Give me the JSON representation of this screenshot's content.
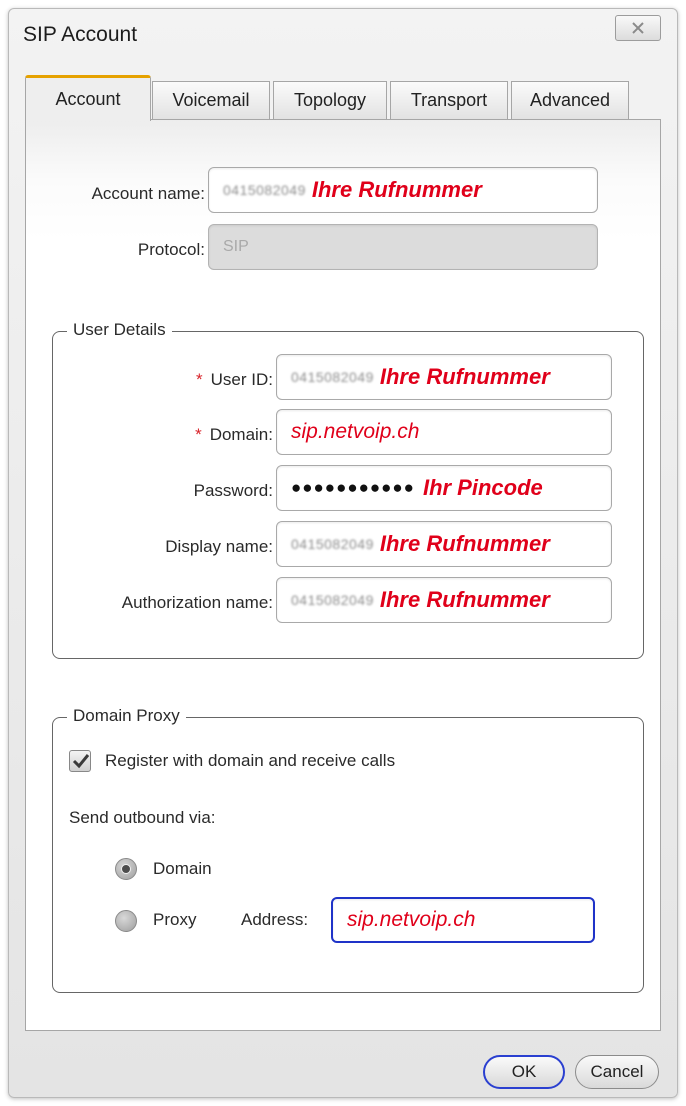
{
  "window": {
    "title": "SIP Account",
    "close_icon": "close-icon"
  },
  "tabs": [
    {
      "label": "Account",
      "active": true
    },
    {
      "label": "Voicemail",
      "active": false
    },
    {
      "label": "Topology",
      "active": false
    },
    {
      "label": "Transport",
      "active": false
    },
    {
      "label": "Advanced",
      "active": false
    }
  ],
  "account": {
    "account_name_label": "Account name:",
    "account_name_value": "0415082049",
    "account_name_note": "Ihre Rufnummer",
    "protocol_label": "Protocol:",
    "protocol_value": "SIP"
  },
  "user_details": {
    "legend": "User Details",
    "required_marker": "*",
    "user_id_label": "User ID:",
    "user_id_value": "0415082049",
    "user_id_note": "Ihre Rufnummer",
    "domain_label": "Domain:",
    "domain_value": "sip.netvoip.ch",
    "password_label": "Password:",
    "password_value": "●●●●●●●●●●●",
    "password_note": "Ihr Pincode",
    "display_name_label": "Display name:",
    "display_name_value": "0415082049",
    "display_name_note": "Ihre Rufnummer",
    "auth_name_label": "Authorization name:",
    "auth_name_value": "0415082049",
    "auth_name_note": "Ihre Rufnummer"
  },
  "domain_proxy": {
    "legend": "Domain Proxy",
    "register_label": "Register with domain and receive calls",
    "register_checked": true,
    "send_via_label": "Send outbound via:",
    "option_domain": "Domain",
    "option_proxy": "Proxy",
    "selected_option": "Domain",
    "address_label": "Address:",
    "address_value": "sip.netvoip.ch"
  },
  "buttons": {
    "ok": "OK",
    "cancel": "Cancel"
  },
  "colors": {
    "tab_accent": "#e6a200",
    "annotation_red": "#e0001a",
    "focus_blue": "#1f33c8"
  }
}
